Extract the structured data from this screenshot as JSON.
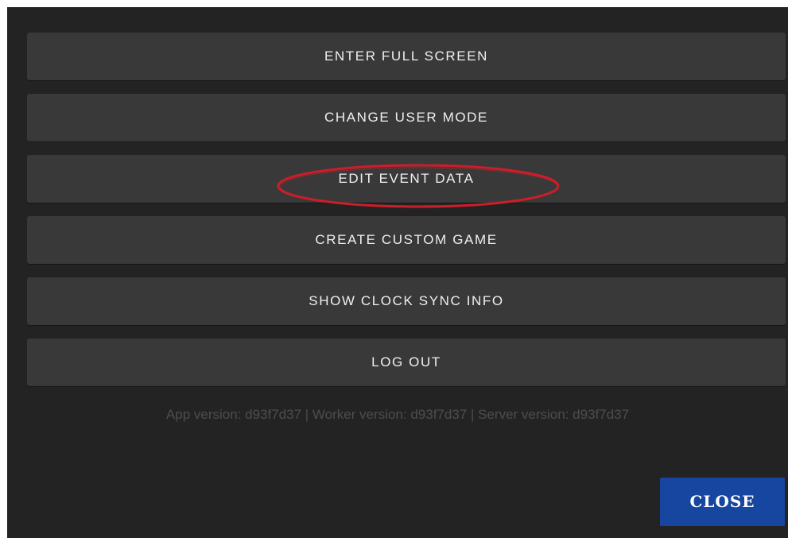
{
  "menu": {
    "items": [
      {
        "label": "ENTER FULL SCREEN"
      },
      {
        "label": "CHANGE USER MODE"
      },
      {
        "label": "EDIT EVENT DATA"
      },
      {
        "label": "CREATE CUSTOM GAME"
      },
      {
        "label": "SHOW CLOCK SYNC INFO"
      },
      {
        "label": "LOG OUT"
      }
    ],
    "highlighted_item": "EDIT EVENT DATA"
  },
  "versions": {
    "text": "App version: d93f7d37 | Worker version: d93f7d37 | Server version: d93f7d37"
  },
  "footer": {
    "close_label": "CLOSE"
  },
  "colors": {
    "dialog_background": "#232323",
    "button_background": "#393939",
    "close_button": "#1746a0",
    "highlight_oval": "#cc1e2a"
  }
}
